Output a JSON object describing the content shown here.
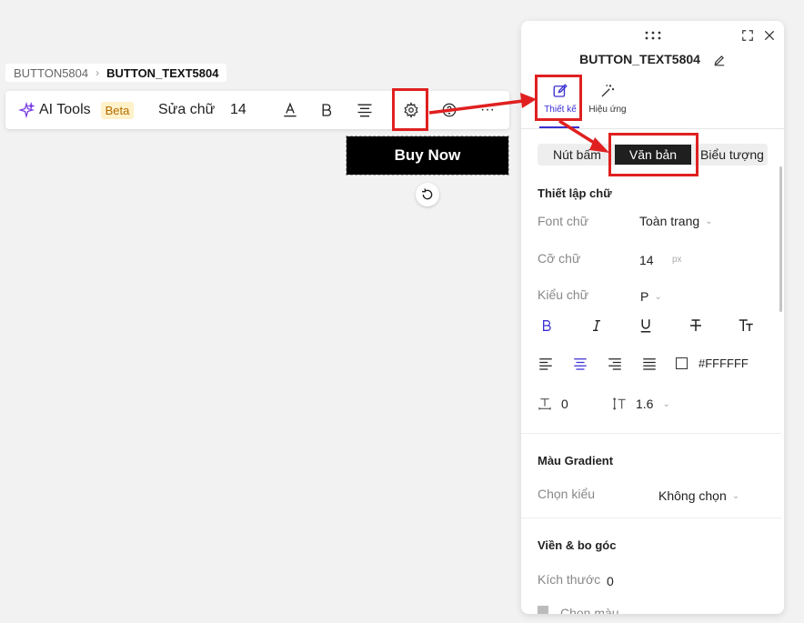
{
  "breadcrumb": {
    "parent": "BUTTON5804",
    "current": "BUTTON_TEXT5804",
    "separator": "›"
  },
  "toolbar": {
    "ai_tools_label": "AI Tools",
    "beta_badge": "Beta",
    "edit_text_label": "Sửa chữ",
    "font_size": "14",
    "more_label": "···"
  },
  "canvas": {
    "button_text": "Buy Now"
  },
  "panel": {
    "title": "BUTTON_TEXT5804",
    "tabs": [
      {
        "label": "Thiết kế",
        "active": true,
        "icon": "edit-icon"
      },
      {
        "label": "Hiệu ứng",
        "active": false,
        "icon": "magic-wand-icon"
      }
    ],
    "segments": [
      {
        "label": "Nút bấm",
        "active": false
      },
      {
        "label": "Văn bản",
        "active": true
      },
      {
        "label": "Biểu tượng",
        "active": false
      }
    ],
    "text_settings": {
      "title": "Thiết lập chữ",
      "font_label": "Font chữ",
      "font_value": "Toàn trang",
      "size_label": "Cỡ chữ",
      "size_value": "14",
      "size_unit": "px",
      "style_label": "Kiểu chữ",
      "style_value": "P",
      "color_value": "#FFFFFF",
      "letter_spacing": "0",
      "line_height": "1.6"
    },
    "gradient": {
      "title": "Màu Gradient",
      "type_label": "Chọn kiểu",
      "type_value": "Không chọn"
    },
    "border": {
      "title": "Viền & bo góc",
      "size_label": "Kích thước",
      "size_value": "0",
      "color_label": "Chọn màu"
    }
  },
  "colors": {
    "accent": "#3a2fd1",
    "annotation": "#e02020",
    "button_bg": "#000000"
  }
}
